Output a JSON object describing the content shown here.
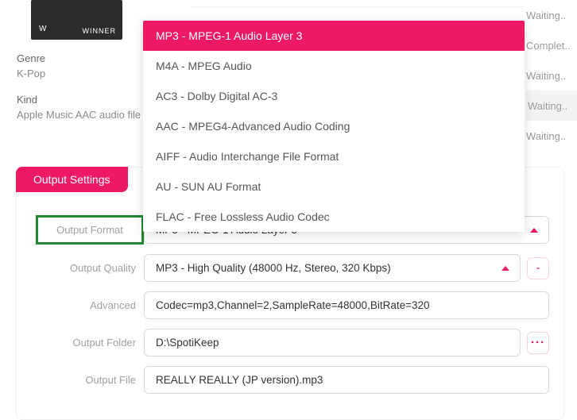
{
  "album": {
    "badge": "WINNER",
    "corner": "W"
  },
  "info": {
    "genre_label": "Genre",
    "genre_value": "K-Pop",
    "kind_label": "Kind",
    "kind_value": "Apple Music AAC audio file"
  },
  "statuses": [
    "Waiting..",
    "Complet..",
    "Waiting..",
    "Waiting..",
    "Waiting.."
  ],
  "settings": {
    "tab": "Output Settings",
    "labels": {
      "format": "Output Format",
      "quality": "Output Quality",
      "advanced": "Advanced",
      "folder": "Output Folder",
      "file": "Output File"
    },
    "format_value": "MP3 - MPEG-1 Audio Layer 3",
    "quality_value": "MP3 - High Quality (48000 Hz, Stereo, 320 Kbps)",
    "advanced_value": "Codec=mp3,Channel=2,SampleRate=48000,BitRate=320",
    "folder_value": "D:\\SpotiKeep",
    "file_value": "REALLY REALLY (JP version).mp3",
    "side_minus": "-",
    "side_dots": "···"
  },
  "dropdown": {
    "items": [
      "MP3 - MPEG-1 Audio Layer 3",
      "M4A - MPEG Audio",
      "AC3 - Dolby Digital AC-3",
      "AAC - MPEG4-Advanced Audio Coding",
      "AIFF - Audio Interchange File Format",
      "AU - SUN AU Format",
      "FLAC - Free Lossless Audio Codec"
    ],
    "selected_index": 0
  }
}
